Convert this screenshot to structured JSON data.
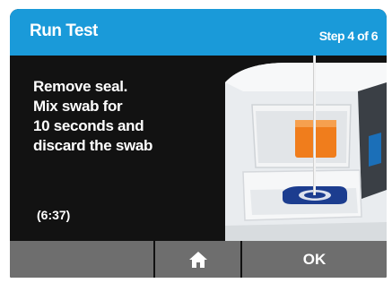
{
  "header": {
    "title": "Run Test",
    "step": "Step 4 of 6"
  },
  "instruction": {
    "lines": [
      "Remove seal.",
      "Mix swab for",
      "10 seconds and",
      "discard the swab"
    ]
  },
  "timer": "(6:37)",
  "footer": {
    "home_icon": "home-icon",
    "ok_label": "OK"
  },
  "colors": {
    "header": "#1a9ad9",
    "background": "#121212",
    "button": "#6e6e6e",
    "accent_orange": "#f07d1c",
    "accent_blue": "#1c3d8f"
  }
}
